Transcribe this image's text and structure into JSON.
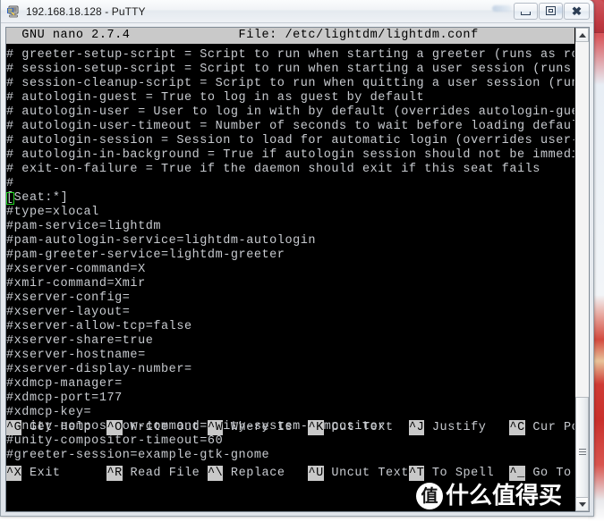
{
  "window": {
    "title": "192.168.18.128 - PuTTY",
    "icon": "putty-icon",
    "buttons": {
      "minimize": "–",
      "maximize": "□",
      "close": "✕"
    }
  },
  "nano": {
    "version_label": "GNU nano 2.7.4",
    "file_label": "File: /etc/lightdm/lightdm.conf",
    "header_line": "  GNU nano 2.7.4              File: /etc/lightdm/lightdm.conf",
    "lines": [
      "# greeter-setup-script = Script to run when starting a greeter (runs as root)",
      "# session-setup-script = Script to run when starting a user session (runs as ro$",
      "# session-cleanup-script = Script to run when quitting a user session (runs as $",
      "# autologin-guest = True to log in as guest by default",
      "# autologin-user = User to log in with by default (overrides autologin-guest)",
      "# autologin-user-timeout = Number of seconds to wait before loading default user",
      "# autologin-session = Session to load for automatic login (overrides user-sessi$",
      "# autologin-in-background = True if autologin session should not be immediately$",
      "# exit-on-failure = True if the daemon should exit if this seat fails",
      "#",
      "[Seat:*]",
      "#type=xlocal",
      "#pam-service=lightdm",
      "#pam-autologin-service=lightdm-autologin",
      "#pam-greeter-service=lightdm-greeter",
      "#xserver-command=X",
      "#xmir-command=Xmir",
      "#xserver-config=",
      "#xserver-layout=",
      "#xserver-allow-tcp=false",
      "#xserver-share=true",
      "#xserver-hostname=",
      "#xserver-display-number=",
      "#xdmcp-manager=",
      "#xdmcp-port=177",
      "#xdmcp-key=",
      "#unity-compositor-command=unity-system-compositor",
      "#unity-compositor-timeout=60",
      "#greeter-session=example-gtk-gnome"
    ],
    "cursor": {
      "line_index": 10,
      "column_index": 0,
      "character": "[",
      "color": "#1fd31f"
    },
    "shortcuts": [
      {
        "key": "^G",
        "label": " Get Help  "
      },
      {
        "key": "^O",
        "label": " Write Out "
      },
      {
        "key": "^W",
        "label": " Where Is  "
      },
      {
        "key": "^K",
        "label": " Cut Text  "
      },
      {
        "key": "^J",
        "label": " Justify   "
      },
      {
        "key": "^C",
        "label": " Cur Pos"
      }
    ],
    "shortcuts_row2": [
      {
        "key": "^X",
        "label": " Exit      "
      },
      {
        "key": "^R",
        "label": " Read File "
      },
      {
        "key": "^\\",
        "label": " Replace   "
      },
      {
        "key": "^U",
        "label": " Uncut Text"
      },
      {
        "key": "^T",
        "label": " To Spell  "
      },
      {
        "key": "^_",
        "label": " Go To Line"
      }
    ],
    "colors": {
      "background": "#000000",
      "foreground": "#c8cbd0",
      "bar_background": "#c9c9c9",
      "bar_foreground": "#000000"
    }
  },
  "scrollbar": {
    "up_arrow": "▲",
    "down_arrow": "▼",
    "thumb_top_pct": 78,
    "thumb_height_pct": 24
  },
  "watermark": {
    "badge": "值",
    "text": "什么值得买"
  }
}
